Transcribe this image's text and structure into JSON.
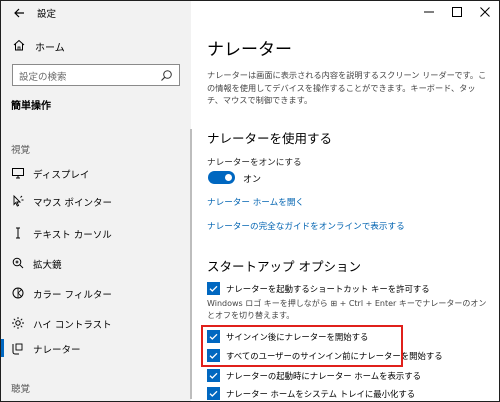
{
  "app": {
    "title": "設定"
  },
  "sidebar": {
    "home_label": "ホーム",
    "search_placeholder": "設定の検索",
    "section_heading": "簡単操作",
    "group_vision": "視覚",
    "items": [
      {
        "label": "ディスプレイ",
        "icon": "monitor-icon"
      },
      {
        "label": "マウス ポインター",
        "icon": "mouse-pointer-icon"
      },
      {
        "label": "テキスト カーソル",
        "icon": "text-cursor-icon"
      },
      {
        "label": "拡大鏡",
        "icon": "magnifier-icon"
      },
      {
        "label": "カラー フィルター",
        "icon": "color-filter-icon"
      },
      {
        "label": "ハイ コントラスト",
        "icon": "high-contrast-icon"
      },
      {
        "label": "ナレーター",
        "icon": "narrator-icon",
        "active": true
      }
    ],
    "group_hearing": "聴覚"
  },
  "main": {
    "title": "ナレーター",
    "description": "ナレーターは画面に表示される内容を説明するスクリーン リーダーです。この情報を使用してデバイスを操作することができます。キーボード、タッチ、マウスで制御できます。",
    "use_section": {
      "heading": "ナレーターを使用する",
      "toggle_label": "ナレーターをオンにする",
      "toggle_state": "オン",
      "links": [
        "ナレーター ホームを開く",
        "ナレーターの完全なガイドをオンラインで表示する"
      ]
    },
    "startup_section": {
      "heading": "スタートアップ オプション",
      "options": [
        {
          "label": "ナレーターを起動するショートカット キーを許可する",
          "checked": true
        },
        {
          "label": "サインイン後にナレーターを開始する",
          "checked": true
        },
        {
          "label": "すべてのユーザーのサインイン前にナレーターを開始する",
          "checked": true
        },
        {
          "label": "ナレーターの起動時にナレーター ホームを表示する",
          "checked": true
        },
        {
          "label": "ナレーター ホームをシステム トレイに最小化する",
          "checked": true
        }
      ],
      "shortcut_note": "Windows ロゴ キーを押しながら ⊞ + Ctrl + Enter キーでナレーターのオンとオフを切り替えます。"
    }
  },
  "colors": {
    "accent": "#0067c0",
    "highlight": "#e0201b",
    "sidebar_bg": "#f2f2f2"
  }
}
